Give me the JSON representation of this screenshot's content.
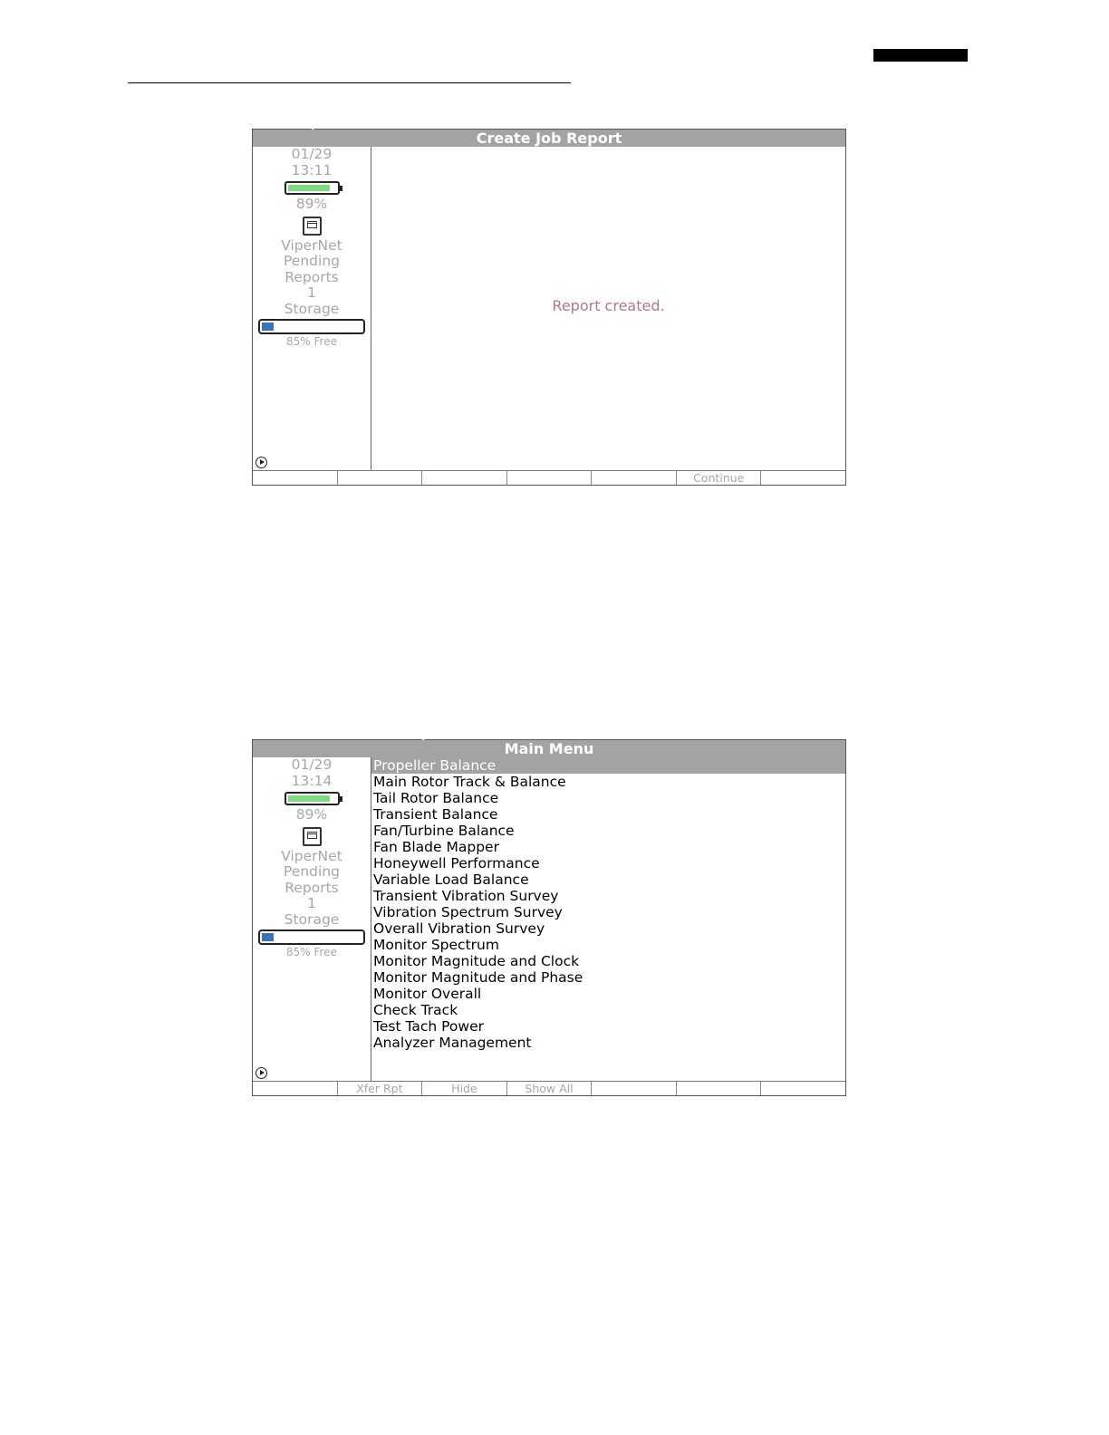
{
  "screens": [
    {
      "title": "Create Job Report",
      "sidebar": {
        "date": "01/29",
        "time": "13:11",
        "battery_level": 0.89,
        "battery_text": "89%",
        "network_icon": "ethernet-port-icon",
        "vipernet_label": "ViperNet",
        "pending_label": "Pending",
        "reports_label": "Reports",
        "pending_count": "1",
        "storage_label": "Storage",
        "storage_used_fraction": 0.15,
        "storage_free_text": "85% Free"
      },
      "message": "Report created.",
      "softkeys": [
        "",
        "",
        "",
        "",
        "",
        "Continue",
        ""
      ]
    },
    {
      "title": "Main Menu",
      "sidebar": {
        "date": "01/29",
        "time": "13:14",
        "battery_level": 0.89,
        "battery_text": "89%",
        "network_icon": "ethernet-port-icon",
        "vipernet_label": "ViperNet",
        "pending_label": "Pending",
        "reports_label": "Reports",
        "pending_count": "1",
        "storage_label": "Storage",
        "storage_used_fraction": 0.15,
        "storage_free_text": "85% Free"
      },
      "menu": [
        "Propeller Balance",
        "Main Rotor Track & Balance",
        "Tail Rotor Balance",
        "Transient Balance",
        "Fan/Turbine Balance",
        "Fan Blade Mapper",
        "Honeywell Performance",
        "Variable Load Balance",
        "Transient Vibration Survey",
        "Vibration Spectrum Survey",
        "Overall Vibration Survey",
        "Monitor Spectrum",
        "Monitor Magnitude and Clock",
        "Monitor Magnitude and Phase",
        "Monitor Overall",
        "Check Track",
        "Test Tach Power",
        "Analyzer Management"
      ],
      "selected_index": 0,
      "softkeys": [
        "",
        "Xfer Rpt",
        "Hide",
        "Show All",
        "",
        "",
        ""
      ]
    }
  ],
  "colors": {
    "titlebar": "#a3a3a3",
    "battery_fill": "#7ddc7d",
    "storage_fill": "#3a74b8",
    "message": "#b27a7f"
  }
}
